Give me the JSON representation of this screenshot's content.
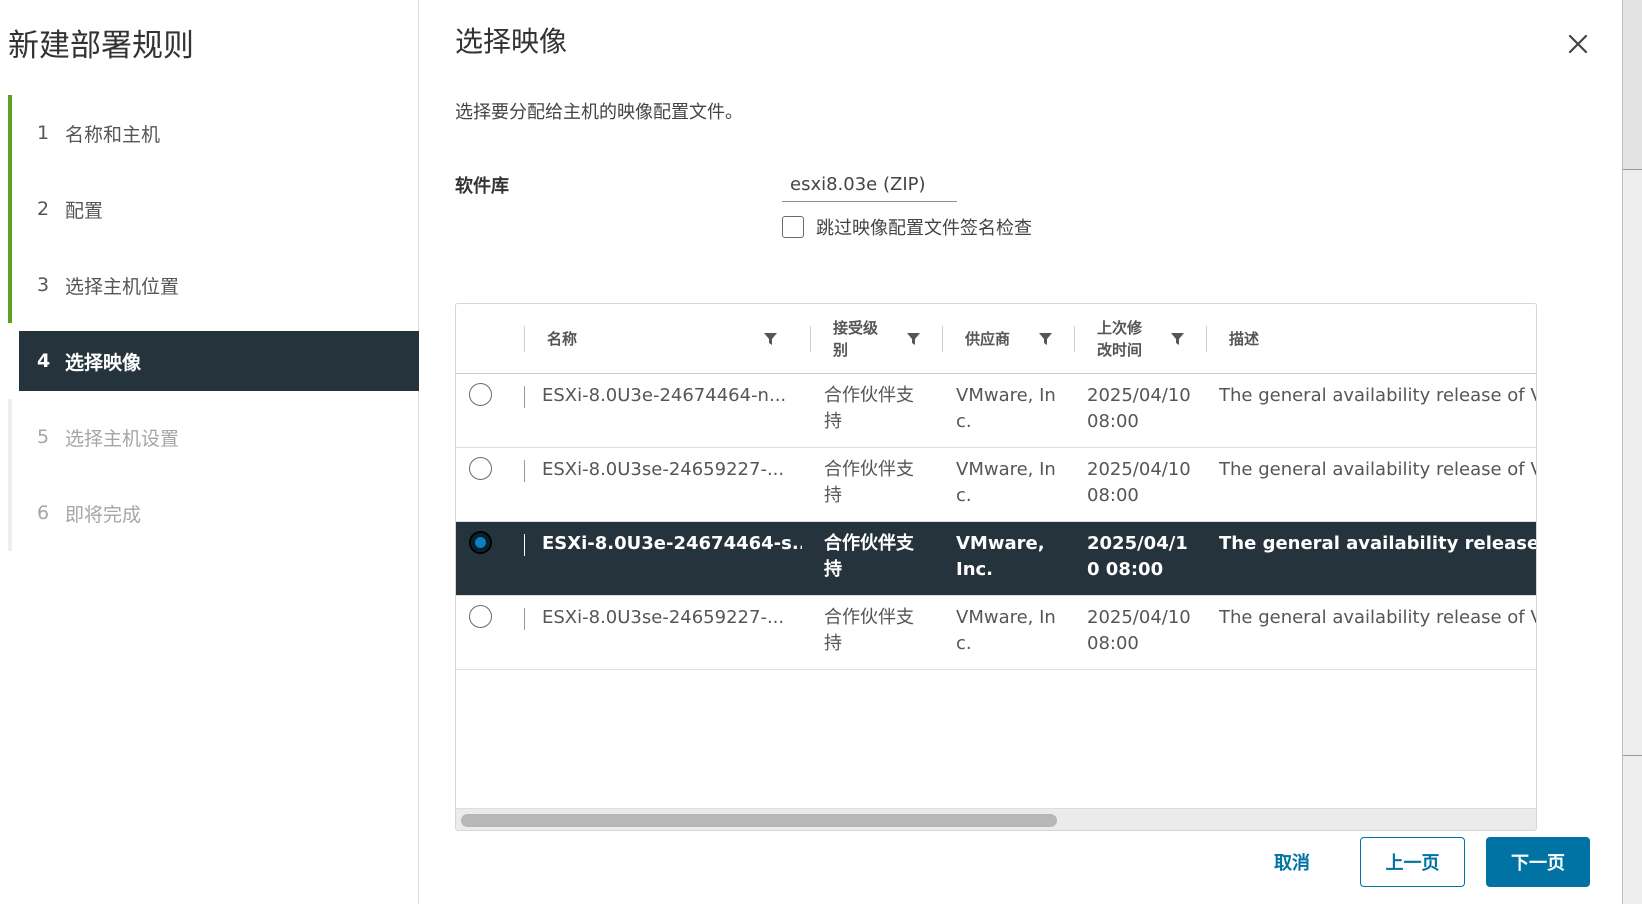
{
  "wizard": {
    "title": "新建部署规则",
    "steps": [
      {
        "num": "1",
        "label": "名称和主机",
        "state": "done"
      },
      {
        "num": "2",
        "label": "配置",
        "state": "done"
      },
      {
        "num": "3",
        "label": "选择主机位置",
        "state": "done"
      },
      {
        "num": "4",
        "label": "选择映像",
        "state": "active"
      },
      {
        "num": "5",
        "label": "选择主机设置",
        "state": "pending"
      },
      {
        "num": "6",
        "label": "即将完成",
        "state": "pending"
      }
    ]
  },
  "main": {
    "title": "选择映像",
    "description": "选择要分配给主机的映像配置文件。",
    "repo_label": "软件库",
    "repo_value": "esxi8.03e (ZIP)",
    "skip_check_label": "跳过映像配置文件签名检查",
    "close_icon": "close-icon"
  },
  "grid": {
    "columns": [
      {
        "key": "name",
        "label": "名称"
      },
      {
        "key": "acceptance",
        "label": "接受级\n别"
      },
      {
        "key": "vendor",
        "label": "供应商"
      },
      {
        "key": "modified",
        "label": "上次修\n改时间"
      },
      {
        "key": "desc",
        "label": "描述"
      }
    ],
    "rows": [
      {
        "name": "ESXi-8.0U3e-24674464-n...",
        "acceptance": "合作伙伴支持",
        "vendor": "VMware, Inc.",
        "modified": "2025/04/10 08:00",
        "desc": "The general availability release of V",
        "selected": false
      },
      {
        "name": "ESXi-8.0U3se-24659227-...",
        "acceptance": "合作伙伴支持",
        "vendor": "VMware, Inc.",
        "modified": "2025/04/10 08:00",
        "desc": "The general availability release of V",
        "selected": false
      },
      {
        "name": "ESXi-8.0U3e-24674464-s...",
        "acceptance": "合作伙伴支持",
        "vendor": "VMware, Inc.",
        "modified": "2025/04/10 08:00",
        "desc": "The general availability release of V",
        "selected": true
      },
      {
        "name": "ESXi-8.0U3se-24659227-...",
        "acceptance": "合作伙伴支持",
        "vendor": "VMware, Inc.",
        "modified": "2025/04/10 08:00",
        "desc": "The general availability release of V",
        "selected": false
      }
    ]
  },
  "footer": {
    "cancel": "取消",
    "prev": "上一页",
    "next": "下一页"
  },
  "colors": {
    "accent": "#0072a3",
    "selected_row": "#25333d",
    "step_done_bar": "#5aa220"
  }
}
